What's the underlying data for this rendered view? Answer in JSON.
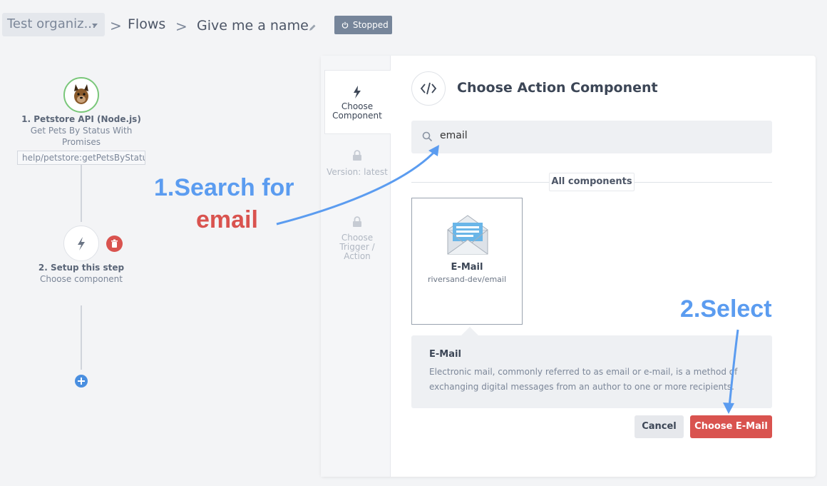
{
  "breadcrumb": {
    "org": "Test organiz...",
    "separator": ">",
    "flows": "Flows",
    "flow_name": "Give me a name",
    "status": "Stopped"
  },
  "flow": {
    "step1": {
      "title": "1. Petstore API (Node.js)",
      "subtitle": "Get Pets By Status With Promises",
      "path": "help/petstore:getPetsByStatusWithPromises"
    },
    "step2": {
      "title": "2. Setup this step",
      "subtitle": "Choose component"
    }
  },
  "sidebar": {
    "tabs": [
      {
        "label": "Choose Component",
        "icon": "bolt-icon",
        "state": "active"
      },
      {
        "label": "Version: latest",
        "icon": "lock-icon",
        "state": "locked"
      },
      {
        "label": "Choose Trigger / Action",
        "icon": "lock-icon",
        "state": "locked"
      }
    ]
  },
  "panel": {
    "title": "Choose Action Component",
    "search_value": "email",
    "section_label": "All components",
    "card": {
      "name": "E-Mail",
      "repo": "riversand-dev/email"
    },
    "description": {
      "title": "E-Mail",
      "text_line1": "Electronic mail, commonly referred to as email or e-mail, is a method of",
      "text_line2": "exchanging digital messages from an author to one or more recipients."
    },
    "cancel_label": "Cancel",
    "choose_label": "Choose E-Mail"
  },
  "annotations": {
    "search_line1": "1.Search for",
    "search_line2": "email",
    "select": "2.Select"
  },
  "colors": {
    "accent_red": "#d9534f",
    "annotation_blue": "#5b9cf0",
    "annotation_red": "#d9534f",
    "status_badge": "#76859a"
  }
}
